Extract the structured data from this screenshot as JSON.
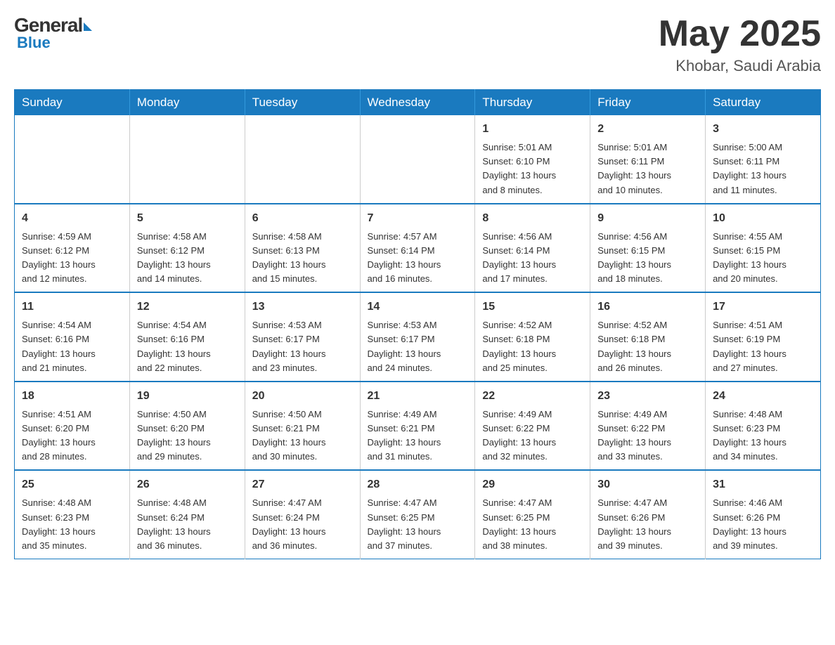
{
  "header": {
    "logo": {
      "general": "General",
      "blue": "Blue"
    },
    "title": "May 2025",
    "location": "Khobar, Saudi Arabia"
  },
  "days_of_week": [
    "Sunday",
    "Monday",
    "Tuesday",
    "Wednesday",
    "Thursday",
    "Friday",
    "Saturday"
  ],
  "weeks": [
    [
      {
        "day": "",
        "info": ""
      },
      {
        "day": "",
        "info": ""
      },
      {
        "day": "",
        "info": ""
      },
      {
        "day": "",
        "info": ""
      },
      {
        "day": "1",
        "info": "Sunrise: 5:01 AM\nSunset: 6:10 PM\nDaylight: 13 hours\nand 8 minutes."
      },
      {
        "day": "2",
        "info": "Sunrise: 5:01 AM\nSunset: 6:11 PM\nDaylight: 13 hours\nand 10 minutes."
      },
      {
        "day": "3",
        "info": "Sunrise: 5:00 AM\nSunset: 6:11 PM\nDaylight: 13 hours\nand 11 minutes."
      }
    ],
    [
      {
        "day": "4",
        "info": "Sunrise: 4:59 AM\nSunset: 6:12 PM\nDaylight: 13 hours\nand 12 minutes."
      },
      {
        "day": "5",
        "info": "Sunrise: 4:58 AM\nSunset: 6:12 PM\nDaylight: 13 hours\nand 14 minutes."
      },
      {
        "day": "6",
        "info": "Sunrise: 4:58 AM\nSunset: 6:13 PM\nDaylight: 13 hours\nand 15 minutes."
      },
      {
        "day": "7",
        "info": "Sunrise: 4:57 AM\nSunset: 6:14 PM\nDaylight: 13 hours\nand 16 minutes."
      },
      {
        "day": "8",
        "info": "Sunrise: 4:56 AM\nSunset: 6:14 PM\nDaylight: 13 hours\nand 17 minutes."
      },
      {
        "day": "9",
        "info": "Sunrise: 4:56 AM\nSunset: 6:15 PM\nDaylight: 13 hours\nand 18 minutes."
      },
      {
        "day": "10",
        "info": "Sunrise: 4:55 AM\nSunset: 6:15 PM\nDaylight: 13 hours\nand 20 minutes."
      }
    ],
    [
      {
        "day": "11",
        "info": "Sunrise: 4:54 AM\nSunset: 6:16 PM\nDaylight: 13 hours\nand 21 minutes."
      },
      {
        "day": "12",
        "info": "Sunrise: 4:54 AM\nSunset: 6:16 PM\nDaylight: 13 hours\nand 22 minutes."
      },
      {
        "day": "13",
        "info": "Sunrise: 4:53 AM\nSunset: 6:17 PM\nDaylight: 13 hours\nand 23 minutes."
      },
      {
        "day": "14",
        "info": "Sunrise: 4:53 AM\nSunset: 6:17 PM\nDaylight: 13 hours\nand 24 minutes."
      },
      {
        "day": "15",
        "info": "Sunrise: 4:52 AM\nSunset: 6:18 PM\nDaylight: 13 hours\nand 25 minutes."
      },
      {
        "day": "16",
        "info": "Sunrise: 4:52 AM\nSunset: 6:18 PM\nDaylight: 13 hours\nand 26 minutes."
      },
      {
        "day": "17",
        "info": "Sunrise: 4:51 AM\nSunset: 6:19 PM\nDaylight: 13 hours\nand 27 minutes."
      }
    ],
    [
      {
        "day": "18",
        "info": "Sunrise: 4:51 AM\nSunset: 6:20 PM\nDaylight: 13 hours\nand 28 minutes."
      },
      {
        "day": "19",
        "info": "Sunrise: 4:50 AM\nSunset: 6:20 PM\nDaylight: 13 hours\nand 29 minutes."
      },
      {
        "day": "20",
        "info": "Sunrise: 4:50 AM\nSunset: 6:21 PM\nDaylight: 13 hours\nand 30 minutes."
      },
      {
        "day": "21",
        "info": "Sunrise: 4:49 AM\nSunset: 6:21 PM\nDaylight: 13 hours\nand 31 minutes."
      },
      {
        "day": "22",
        "info": "Sunrise: 4:49 AM\nSunset: 6:22 PM\nDaylight: 13 hours\nand 32 minutes."
      },
      {
        "day": "23",
        "info": "Sunrise: 4:49 AM\nSunset: 6:22 PM\nDaylight: 13 hours\nand 33 minutes."
      },
      {
        "day": "24",
        "info": "Sunrise: 4:48 AM\nSunset: 6:23 PM\nDaylight: 13 hours\nand 34 minutes."
      }
    ],
    [
      {
        "day": "25",
        "info": "Sunrise: 4:48 AM\nSunset: 6:23 PM\nDaylight: 13 hours\nand 35 minutes."
      },
      {
        "day": "26",
        "info": "Sunrise: 4:48 AM\nSunset: 6:24 PM\nDaylight: 13 hours\nand 36 minutes."
      },
      {
        "day": "27",
        "info": "Sunrise: 4:47 AM\nSunset: 6:24 PM\nDaylight: 13 hours\nand 36 minutes."
      },
      {
        "day": "28",
        "info": "Sunrise: 4:47 AM\nSunset: 6:25 PM\nDaylight: 13 hours\nand 37 minutes."
      },
      {
        "day": "29",
        "info": "Sunrise: 4:47 AM\nSunset: 6:25 PM\nDaylight: 13 hours\nand 38 minutes."
      },
      {
        "day": "30",
        "info": "Sunrise: 4:47 AM\nSunset: 6:26 PM\nDaylight: 13 hours\nand 39 minutes."
      },
      {
        "day": "31",
        "info": "Sunrise: 4:46 AM\nSunset: 6:26 PM\nDaylight: 13 hours\nand 39 minutes."
      }
    ]
  ]
}
